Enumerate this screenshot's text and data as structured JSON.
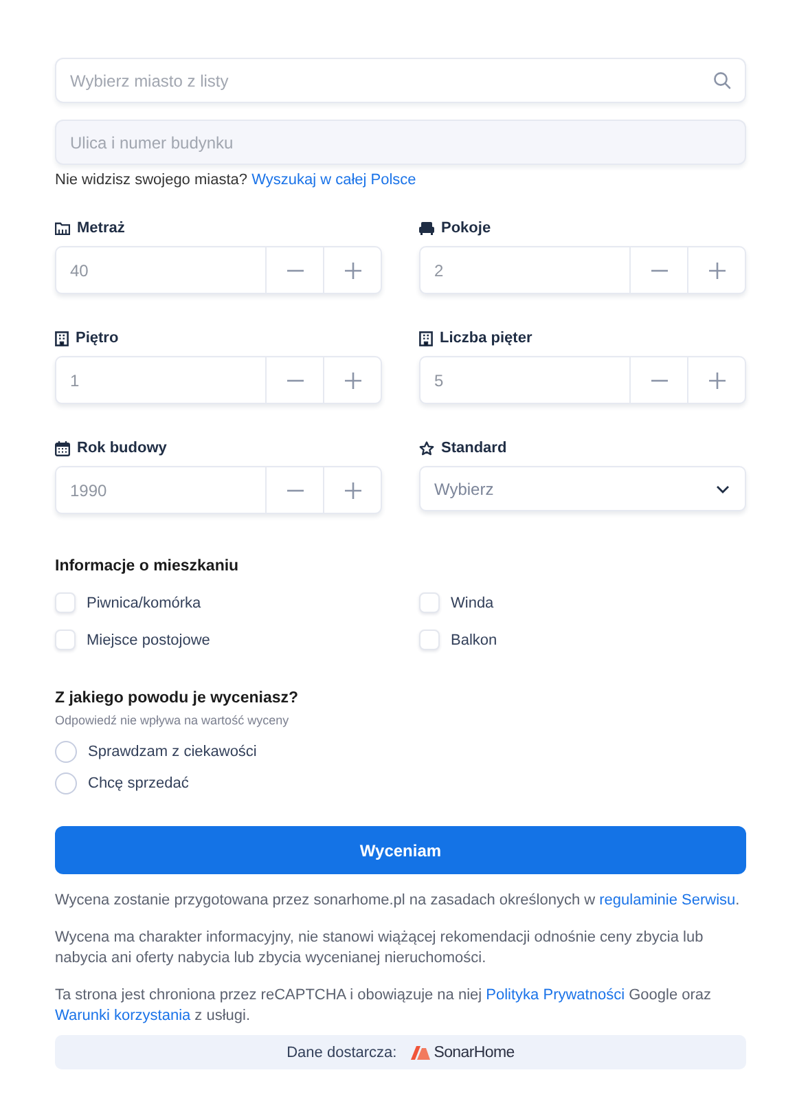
{
  "city_field": {
    "placeholder": "Wybierz miasto z listy"
  },
  "street_field": {
    "placeholder": "Ulica i numer budynku"
  },
  "city_hint": {
    "text": "Nie widzisz swojego miasta?",
    "link": "Wyszukaj w całej Polsce"
  },
  "fields": [
    {
      "kind": "stepper",
      "label": "Metraż",
      "value": "40"
    },
    {
      "kind": "stepper",
      "label": "Pokoje",
      "value": "2"
    },
    {
      "kind": "stepper",
      "label": "Piętro",
      "value": "1"
    },
    {
      "kind": "stepper",
      "label": "Liczba pięter",
      "value": "5"
    },
    {
      "kind": "stepper",
      "label": "Rok budowy",
      "value": "1990"
    },
    {
      "kind": "select",
      "label": "Standard",
      "placeholder": "Wybierz"
    }
  ],
  "apartment_info": {
    "title": "Informacje o mieszkaniu",
    "options": [
      {
        "label": "Piwnica/komórka",
        "checked": false
      },
      {
        "label": "Winda",
        "checked": false
      },
      {
        "label": "Miejsce postojowe",
        "checked": false
      },
      {
        "label": "Balkon",
        "checked": false
      }
    ]
  },
  "reason": {
    "title": "Z jakiego powodu je wyceniasz?",
    "hint": "Odpowiedź nie wpływa na wartość wyceny",
    "options": [
      {
        "label": "Sprawdzam z ciekawości",
        "selected": false
      },
      {
        "label": "Chcę sprzedać",
        "selected": false
      }
    ]
  },
  "submit_button": "Wyceniam",
  "notes": [
    [
      {
        "kind": "text",
        "text": "Wycena zostanie przygotowana przez sonarhome.pl na zasadach określonych w "
      },
      {
        "kind": "link",
        "text": "regulaminie Serwisu"
      },
      {
        "kind": "text",
        "text": "."
      }
    ],
    [
      {
        "kind": "text",
        "text": "Wycena ma charakter informacyjny, nie stanowi wiążącej rekomendacji odnośnie ceny zbycia lub nabycia ani oferty nabycia lub zbycia wycenianej nieruchomości."
      }
    ],
    [
      {
        "kind": "text",
        "text": "Ta strona jest chroniona przez reCAPTCHA i obowiązuje na niej "
      },
      {
        "kind": "link",
        "text": "Polityka Prywatności"
      },
      {
        "kind": "text",
        "text": " Google oraz "
      },
      {
        "kind": "link",
        "text": "Warunki korzystania"
      },
      {
        "kind": "text",
        "text": " z usługi."
      }
    ]
  ],
  "provider": {
    "label": "Dane dostarcza:",
    "logo_text": "SonarHome"
  }
}
